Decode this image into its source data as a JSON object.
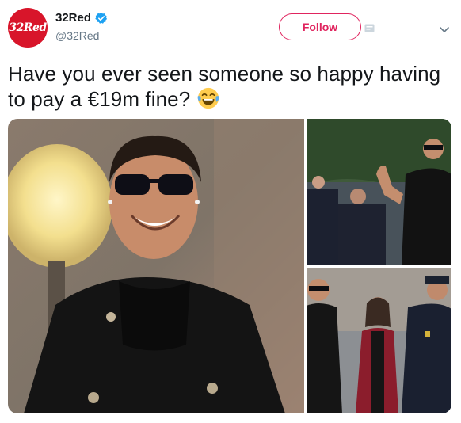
{
  "tweet": {
    "display_name": "32Red",
    "handle": "@32Red",
    "avatar_text": "32Red",
    "follow_label": "Follow",
    "text": "Have you ever seen someone so happy having to pay a €19m fine?",
    "emoji": "face-with-tears-of-joy-icon",
    "media": [
      {
        "label": "photo-smiling-man-sunglasses"
      },
      {
        "label": "photo-man-waving"
      },
      {
        "label": "photo-man-walking-with-woman"
      }
    ]
  },
  "colors": {
    "brand_red": "#d8152a",
    "follow_pink": "#e0245e",
    "verified_blue": "#1da1f2",
    "handle_gray": "#657786"
  }
}
